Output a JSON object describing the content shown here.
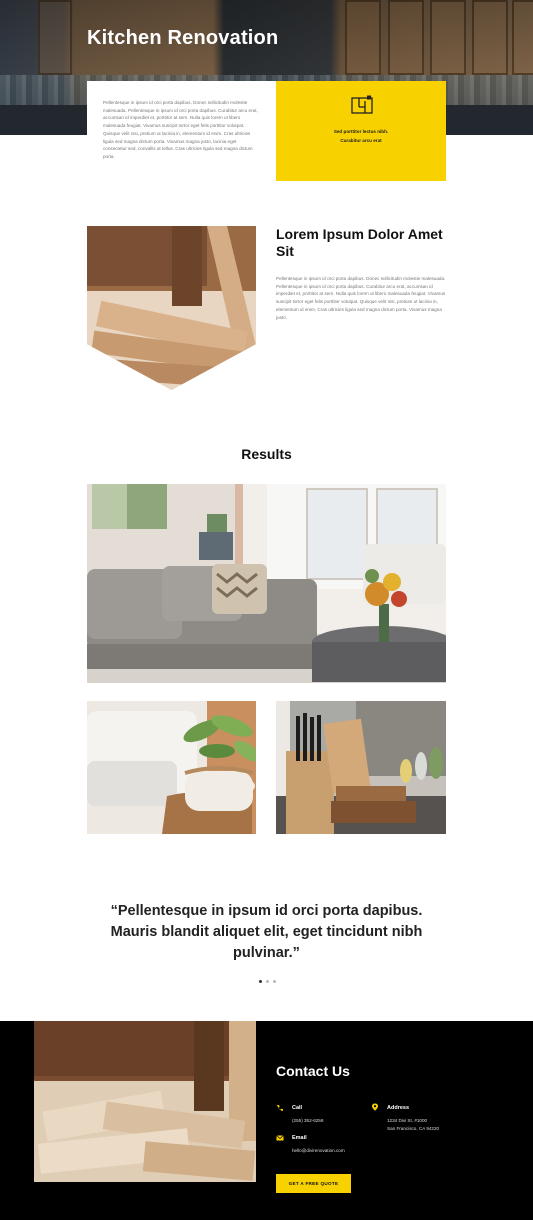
{
  "hero": {
    "title": "Kitchen Renovation"
  },
  "intro": {
    "body": "Pellentesque in ipsum id orci porta dapibus. Donec sollicitudin molestie malesuada. Pellentesque in ipsum id orci porta dapibus. Curabitur arcu erat, accumsan id imperdiet et, porttitor at sem. Nulla quis lorem ut libero malesuada feugiat. Vivamus suscipit tortor eget felis porttitor volutpat. Quisque velit nisi, pretium ut lacinia in, elementum id enim. Cras ultricies ligula sed magna dictum porta. Vivamus magna justo, lacinia eget consectetur sed, convallis at tellus. Cras ultricies ligula sed magna dictum porta.",
    "feature_icon": "floor-plan-icon",
    "feature_line1": "Sed porttitor lectus nibh.",
    "feature_line2": "Curabitur arcu erat"
  },
  "section2": {
    "title": "Lorem Ipsum Dolor Amet Sit",
    "body": "Pellentesque in ipsum id orci porta dapibus. Donec sollicitudin molestie malesuada. Pellentesque in ipsum id orci porta dapibus. Curabitur arcu erat, accumsan id imperdiet et, porttitor at sem. Nulla quis lorem ut libero malesuada feugiat. Vivamus suscipit tortor eget felis porttitor volutpat. Quisque velit nisi, pretium ut lacinia in, elementum id enim. Cras ultricies ligula sed magna dictum porta. Vivamus magna justo."
  },
  "results": {
    "title": "Results"
  },
  "testimonial": {
    "quote": "“Pellentesque in ipsum id orci porta dapibus. Mauris blandit aliquet elit, eget tincidunt nibh pulvinar.”",
    "active_slide": 1,
    "slide_count": 3
  },
  "contact": {
    "title": "Contact Us",
    "call_label": "Call",
    "call_value": "(255) 352-6258",
    "email_label": "Email",
    "email_value": "hello@divirenovation.com",
    "address_label": "Address",
    "address_line1": "1234 Divi St. #1000",
    "address_line2": "San Francisco, CA 94220",
    "cta_label": "GET A FREE QUOTE"
  },
  "colors": {
    "accent": "#f8d100",
    "footer_bg": "#000000",
    "heading": "#111111"
  }
}
